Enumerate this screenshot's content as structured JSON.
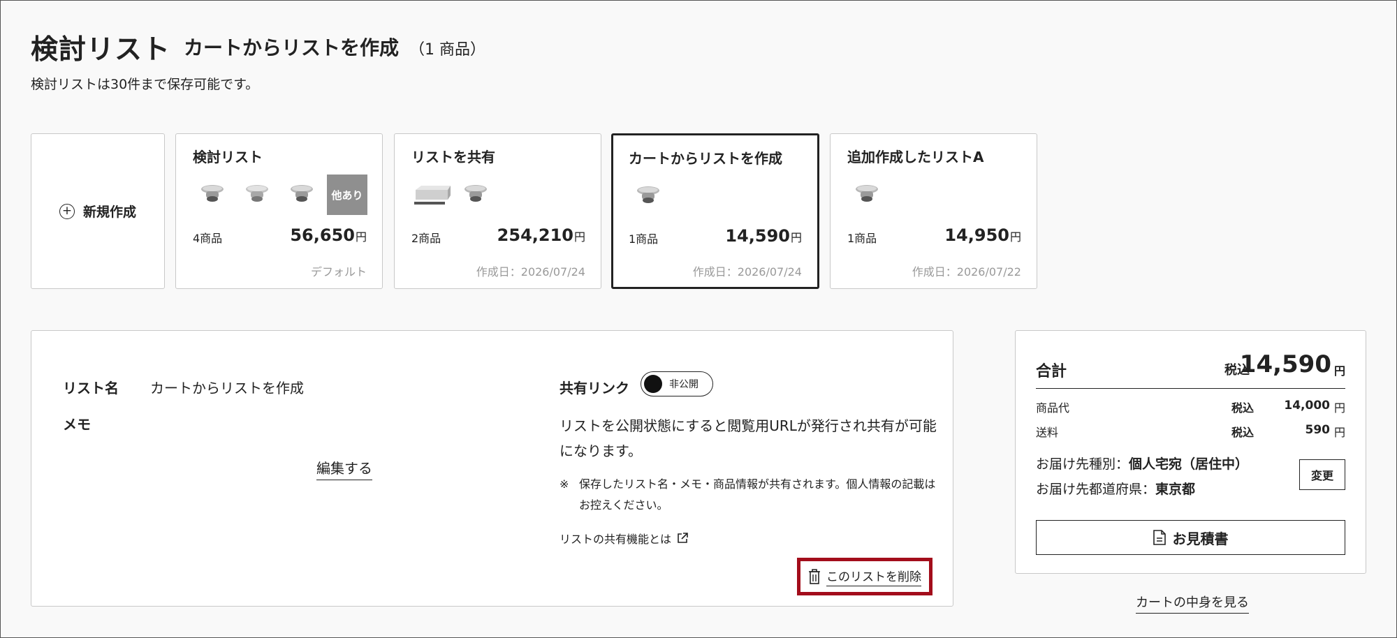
{
  "header": {
    "title": "検討リスト",
    "subtitle": "カートからリストを作成",
    "count": "（1 商品）",
    "description": "検討リストは30件まで保存可能です。"
  },
  "new_card": {
    "label": "新規作成"
  },
  "lists": [
    {
      "name": "検討リスト",
      "items": "4商品",
      "price": "56,650",
      "yen": "円",
      "meta": "デフォルト",
      "more_label": "他あり"
    },
    {
      "name": "リストを共有",
      "items": "2商品",
      "price": "254,210",
      "yen": "円",
      "meta": "作成日：2026/07/24"
    },
    {
      "name": "カートからリストを作成",
      "items": "1商品",
      "price": "14,590",
      "yen": "円",
      "meta": "作成日：2026/07/24"
    },
    {
      "name": "追加作成したリストA",
      "items": "1商品",
      "price": "14,950",
      "yen": "円",
      "meta": "作成日：2026/07/22"
    }
  ],
  "detail": {
    "list_name_label": "リスト名",
    "list_name_value": "カートからリストを作成",
    "memo_label": "メモ",
    "edit_label": "編集する",
    "share_link_label": "共有リンク",
    "toggle_state": "非公開",
    "share_description": "リストを公開状態にすると閲覧用URLが発行され共有が可能になります。",
    "note_mark": "※",
    "share_note": "保存したリスト名・メモ・商品情報が共有されます。個人情報の記載はお控えください。",
    "share_help": "リストの共有機能とは",
    "delete_label": "このリストを削除"
  },
  "summary": {
    "total_label": "合計",
    "tax_label": "税込",
    "total_value": "14,590",
    "yen": "円",
    "rows": [
      {
        "label": "商品代",
        "tax": "税込",
        "value": "14,000",
        "yen": "円"
      },
      {
        "label": "送料",
        "tax": "税込",
        "value": "590",
        "yen": "円"
      }
    ],
    "delivery_type_label": "お届け先種別：",
    "delivery_type_value": "個人宅宛（居住中）",
    "delivery_pref_label": "お届け先都道府県：",
    "delivery_pref_value": "東京都",
    "change_label": "変更",
    "quote_label": "お見積書"
  },
  "cart_link": "カートの中身を見る"
}
